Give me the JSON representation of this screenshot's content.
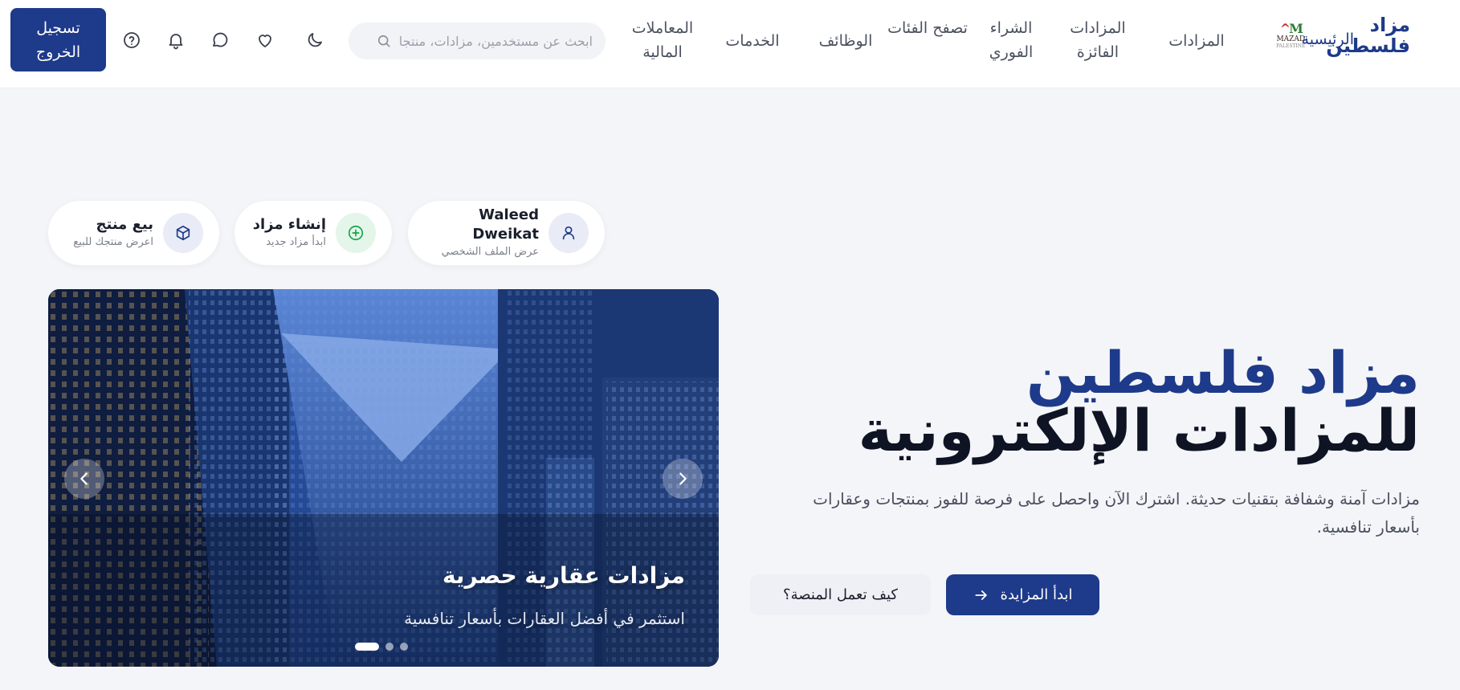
{
  "header": {
    "brand": {
      "name_line1": "مزاد",
      "name_line2": "فلسطين",
      "logo_text": "MAZAD",
      "logo_tagline": "PALESTINE"
    },
    "nav": [
      {
        "label": "الرئيسية"
      },
      {
        "label": "المزادات"
      },
      {
        "label": "المزادات الفائزة"
      },
      {
        "label": "الشراء الفوري"
      },
      {
        "label": "تصفح الفئات"
      },
      {
        "label": "الوظائف"
      },
      {
        "label": "الخدمات"
      },
      {
        "label": "المعاملات المالية"
      }
    ],
    "search": {
      "placeholder": "ابحث عن مستخدمين، مزادات، منتجات",
      "value": "",
      "icon": "search-icon"
    },
    "icons": [
      "moon-icon",
      "heart-icon",
      "chat-icon",
      "bell-icon",
      "help-icon"
    ],
    "logout_label": "تسجيل\nالخروج"
  },
  "quick_actions": [
    {
      "title": "Waleed Dweikat",
      "subtitle": "عرض الملف الشخصي",
      "icon": "user-icon",
      "color": "#1e3a8a",
      "bg": "#e9ecf6"
    },
    {
      "title": "إنشاء مزاد",
      "subtitle": "ابدأ مزاد جديد",
      "icon": "plus-circle-icon",
      "color": "#16a34a",
      "bg": "#e4f5ea"
    },
    {
      "title": "بيع منتج",
      "subtitle": "اعرض منتجك للبيع",
      "icon": "package-icon",
      "color": "#1e3a8a",
      "bg": "#e9ecf6"
    }
  ],
  "slider": {
    "title": "مزادات عقارية حصرية",
    "subtitle": "استثمر في أفضل العقارات بأسعار تنافسية",
    "slide_count": 3,
    "active_index": 0
  },
  "hero": {
    "title_accent": "مزاد فلسطين",
    "title_rest": "للمزادات الإلكترونية",
    "description": "مزادات آمنة وشفافة بتقنيات حديثة. اشترك الآن واحصل على فرصة للفوز بمنتجات وعقارات بأسعار تنافسية.",
    "primary_button": "ابدأ المزايدة",
    "secondary_button": "كيف تعمل المنصة؟"
  },
  "colors": {
    "brand": "#1e3a8a",
    "background": "#f4f5f8",
    "text_dark": "#0f1424",
    "success": "#16a34a"
  }
}
